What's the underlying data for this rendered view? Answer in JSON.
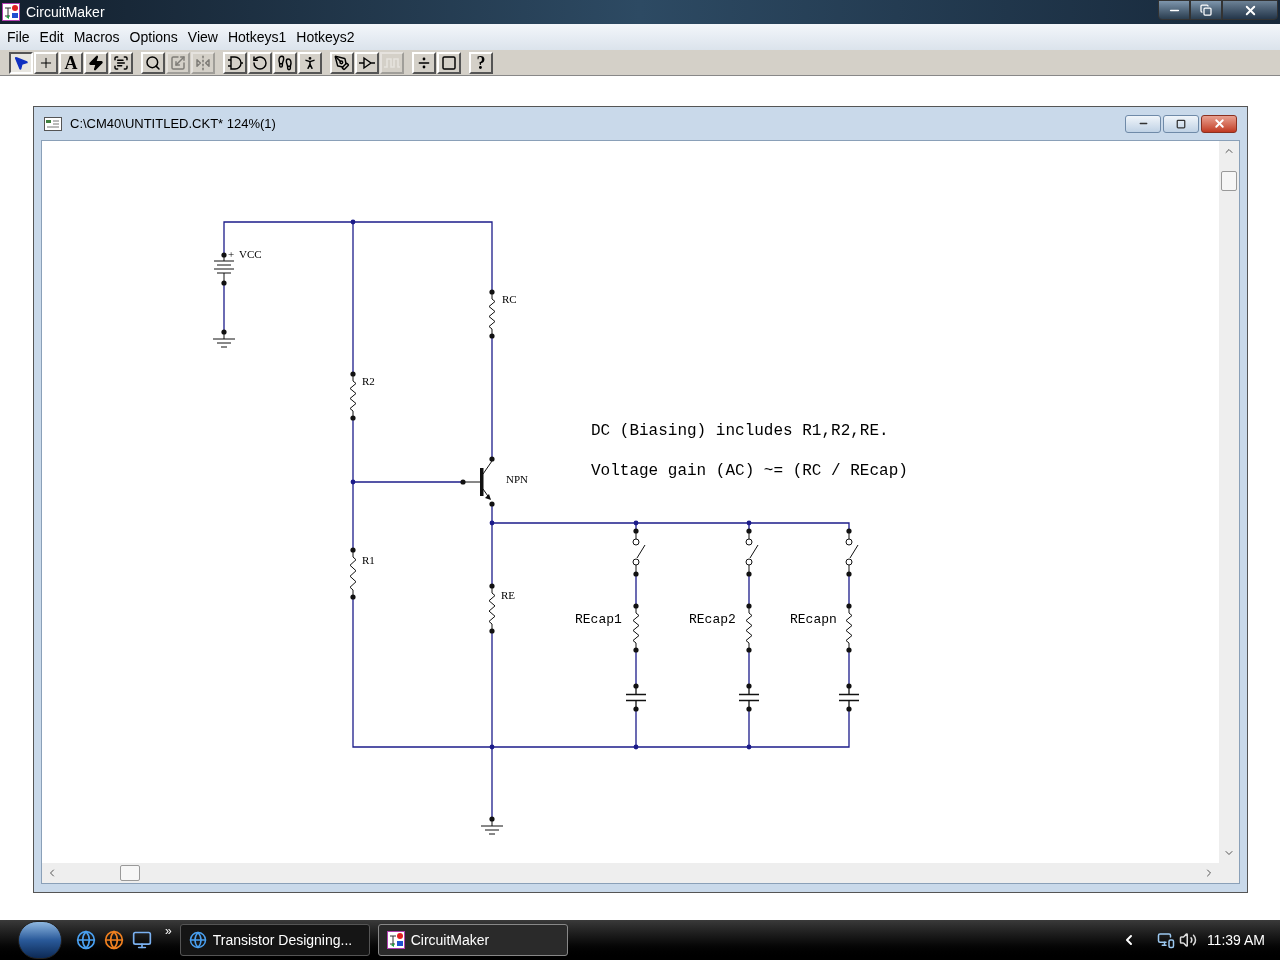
{
  "app": {
    "title": "CircuitMaker"
  },
  "menu": [
    {
      "label": "File"
    },
    {
      "label": "Edit"
    },
    {
      "label": "Macros"
    },
    {
      "label": "Options"
    },
    {
      "label": "View"
    },
    {
      "label": "Hotkeys1"
    },
    {
      "label": "Hotkeys2"
    }
  ],
  "toolbar": [
    [
      {
        "kind": "pointer",
        "selected": true,
        "disabled": false
      },
      {
        "kind": "plus",
        "selected": false,
        "disabled": false
      },
      {
        "kind": "glyph",
        "glyph": "A",
        "selected": false,
        "disabled": false
      },
      {
        "kind": "zap",
        "selected": false,
        "disabled": false
      },
      {
        "kind": "label",
        "selected": false,
        "disabled": false
      }
    ],
    [
      {
        "kind": "search",
        "selected": false,
        "disabled": false
      },
      {
        "kind": "scale",
        "selected": false,
        "disabled": true
      },
      {
        "kind": "flip",
        "selected": false,
        "disabled": true
      }
    ],
    [
      {
        "kind": "gate",
        "selected": false,
        "disabled": false
      },
      {
        "kind": "rotate",
        "selected": false,
        "disabled": false
      },
      {
        "kind": "step",
        "selected": false,
        "disabled": false
      },
      {
        "kind": "run",
        "selected": false,
        "disabled": false
      }
    ],
    [
      {
        "kind": "probe",
        "selected": false,
        "disabled": false
      },
      {
        "kind": "buffer",
        "selected": false,
        "disabled": false
      },
      {
        "kind": "wave",
        "selected": false,
        "disabled": true
      }
    ],
    [
      {
        "kind": "divide",
        "selected": false,
        "disabled": false
      },
      {
        "kind": "chip",
        "selected": false,
        "disabled": false
      }
    ],
    [
      {
        "kind": "glyph",
        "glyph": "?",
        "selected": false,
        "disabled": false
      }
    ]
  ],
  "document": {
    "title": "C:\\CM40\\UNTITLED.CKT* 124%(1)"
  },
  "schematic": {
    "source": {
      "label": "VCC",
      "polarity": "+"
    },
    "resistors": [
      {
        "label": "RC"
      },
      {
        "label": "R2"
      },
      {
        "label": "R1"
      },
      {
        "label": "RE"
      }
    ],
    "transistor": {
      "label": "NPN"
    },
    "branches": [
      {
        "label": "REcap1",
        "switch_closed": false
      },
      {
        "label": "REcap2",
        "switch_closed": false
      },
      {
        "label": "REcapn",
        "switch_closed": false
      }
    ],
    "notes": [
      "DC (Biasing) includes R1,R2,RE.",
      "Voltage gain (AC) ~= (RC / REcap)"
    ]
  },
  "taskbar": {
    "overflow": "»",
    "tasks": [
      {
        "label": "Transistor Designing...",
        "kind": "browser",
        "selected": false
      },
      {
        "label": "CircuitMaker",
        "kind": "app",
        "selected": true
      }
    ],
    "clock": "11:39 AM"
  }
}
